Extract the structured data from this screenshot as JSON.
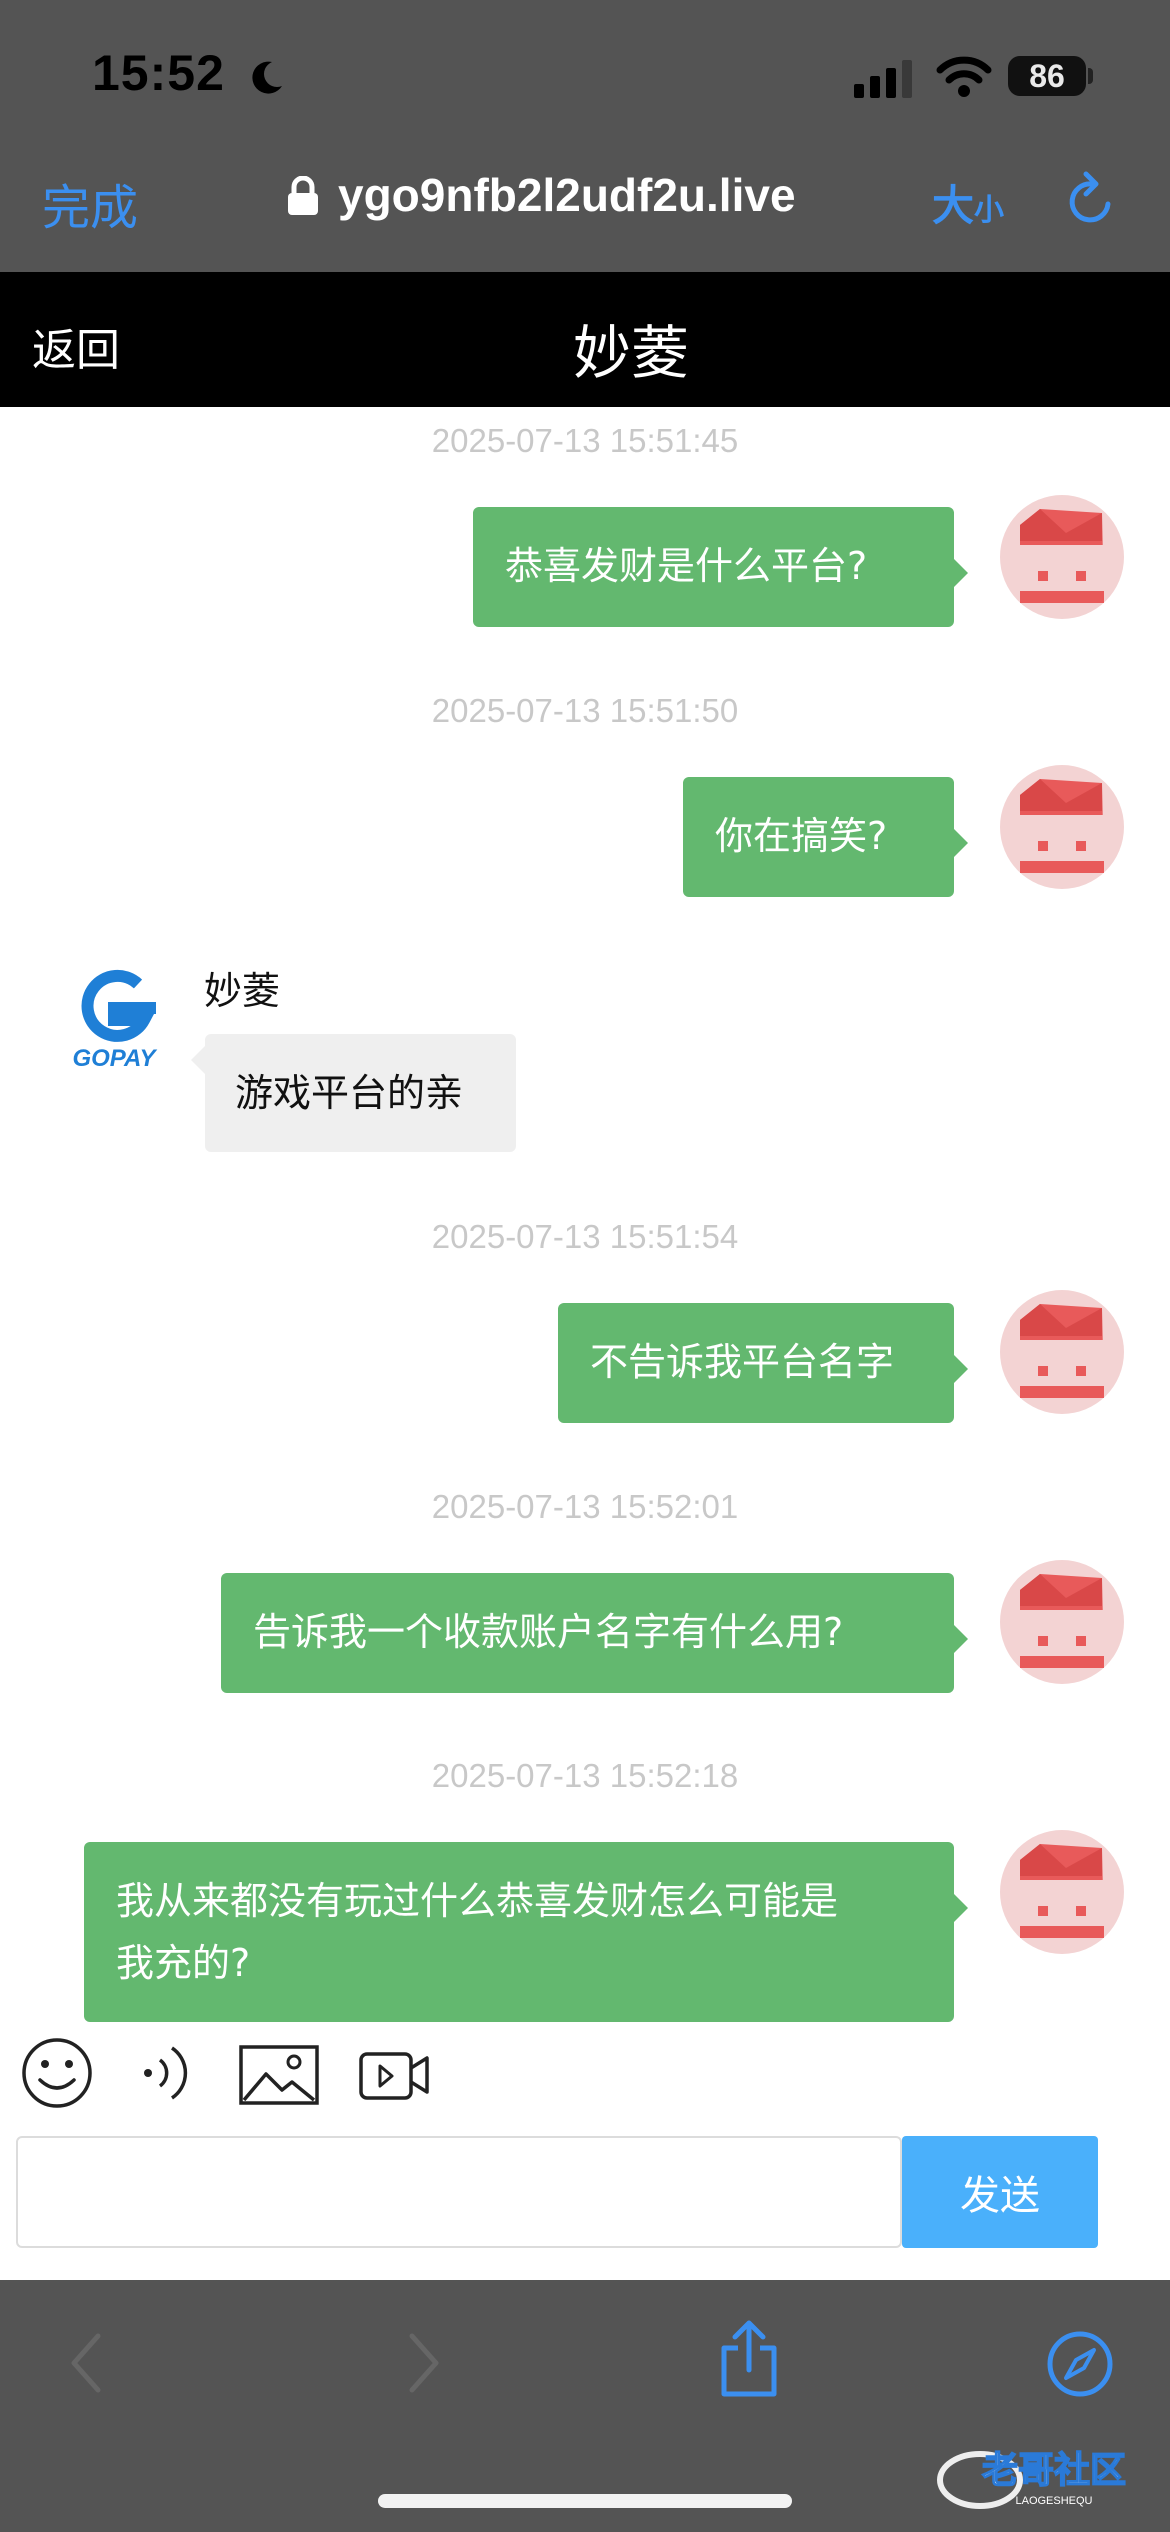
{
  "status_bar": {
    "time": "15:52",
    "battery": "86",
    "icons": [
      "moon-icon",
      "signal-icon",
      "wifi-icon",
      "battery-icon"
    ]
  },
  "browser": {
    "done_label": "完成",
    "url": "ygo9nfb2l2udf2u.live",
    "text_size_big": "大",
    "text_size_small": "小",
    "accent_color": "#3b8ff0"
  },
  "chat": {
    "back_label": "返回",
    "title": "妙菱",
    "outgoing_color": "#63b86f",
    "messages": [
      {
        "timestamp": "2025-07-13 15:51:45",
        "text": "恭喜发财是什么平台?"
      },
      {
        "timestamp": "2025-07-13 15:51:50",
        "text": "你在搞笑?"
      },
      {
        "sender": "妙菱",
        "text": "游戏平台的亲",
        "avatar_text": "GOPAY"
      },
      {
        "timestamp": "2025-07-13 15:51:54",
        "text": "不告诉我平台名字"
      },
      {
        "timestamp": "2025-07-13 15:52:01",
        "text": "告诉我一个收款账户名字有什么用?"
      },
      {
        "timestamp": "2025-07-13 15:52:18",
        "text_line1": "我从来都没有玩过什么恭喜发财怎么可能是",
        "text_line2": "我充的?"
      }
    ]
  },
  "composer": {
    "tools": [
      "emoji-icon",
      "voice-icon",
      "image-icon",
      "video-icon"
    ],
    "input_value": "",
    "send_label": "发送",
    "send_color": "#4ab0fb"
  },
  "safari_toolbar": {
    "icons": [
      "back-arrow-icon",
      "forward-arrow-icon",
      "share-icon",
      "compass-icon"
    ]
  },
  "watermark": {
    "text": "老哥社区",
    "subtext": "LAOGESHEQU"
  }
}
